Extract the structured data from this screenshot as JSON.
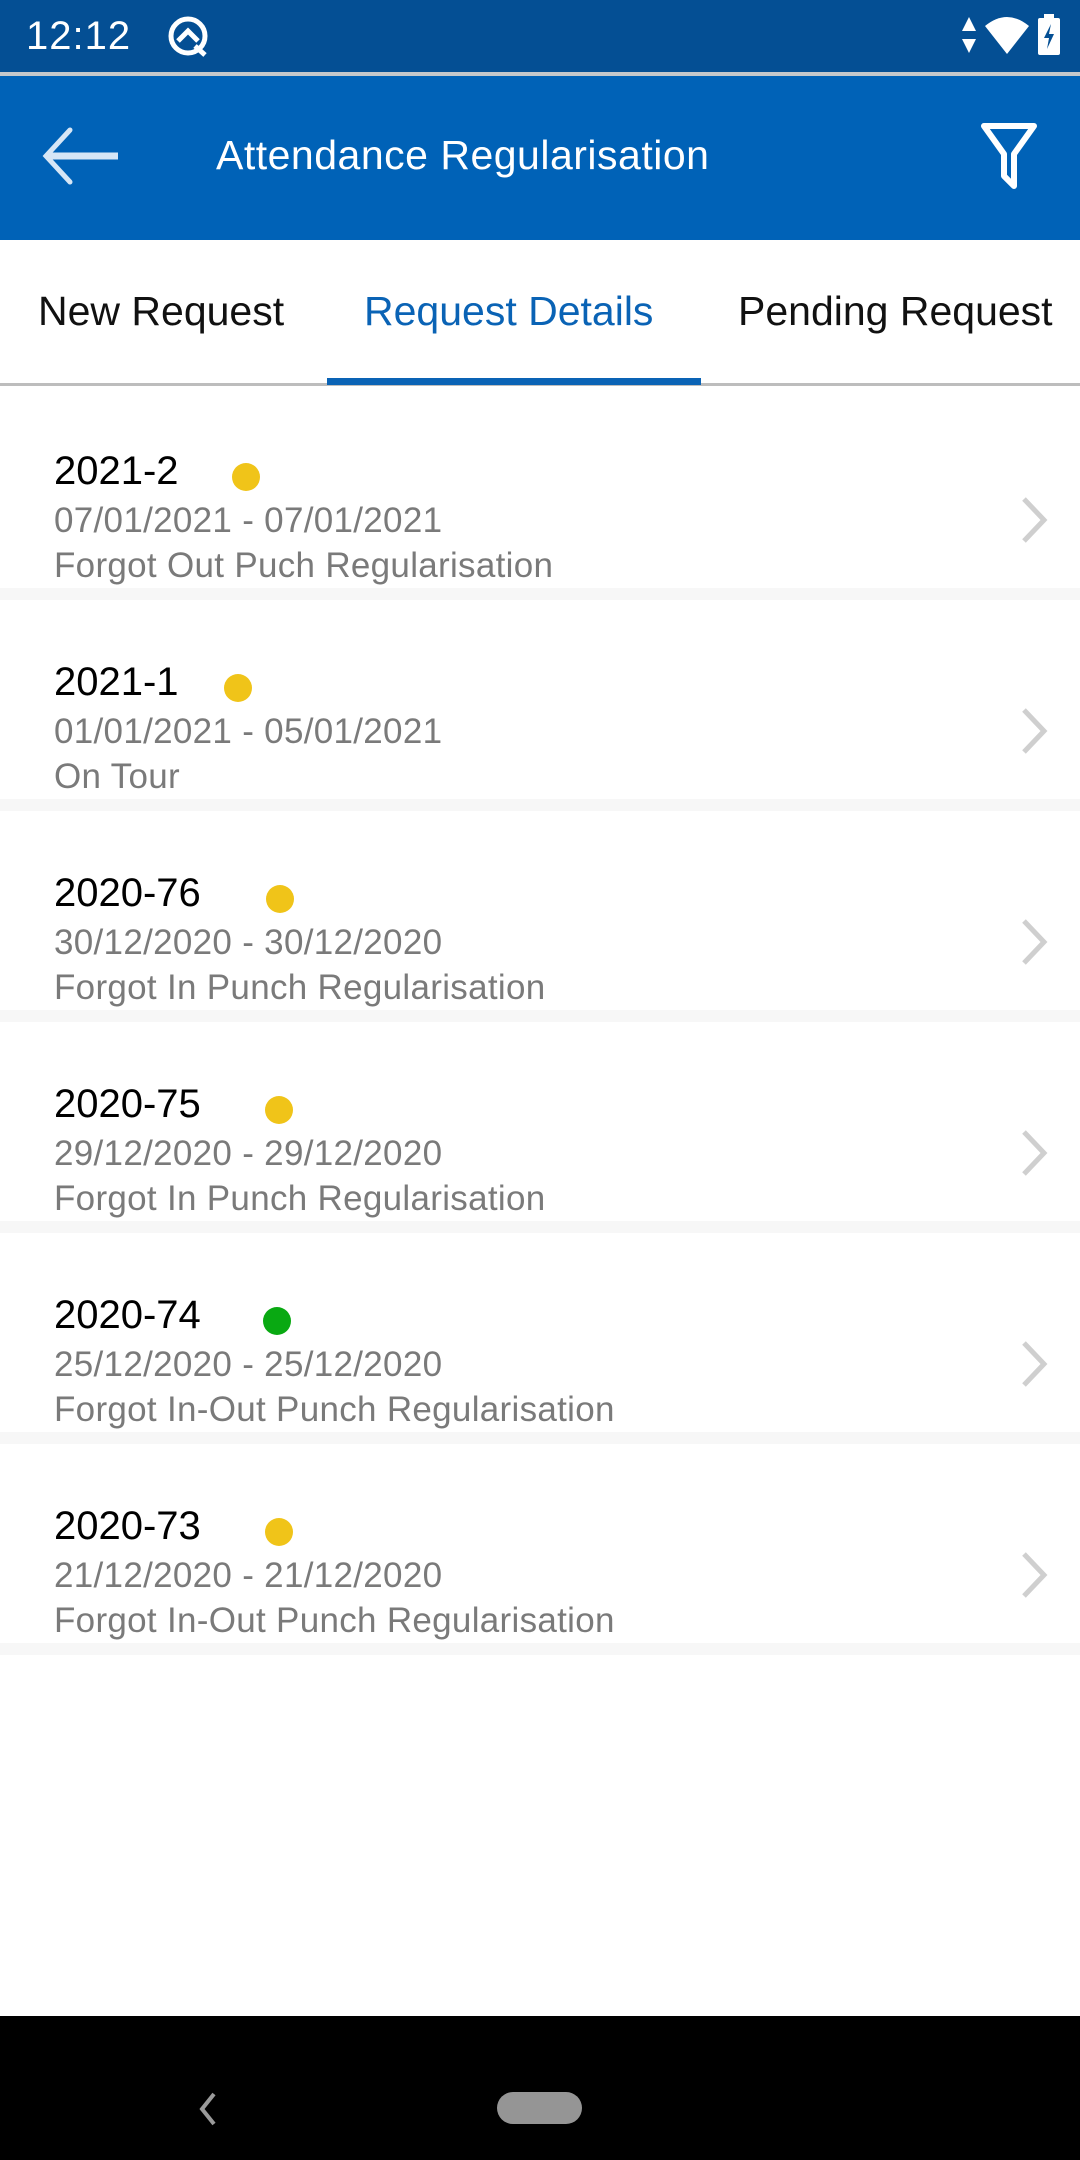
{
  "status_bar": {
    "time": "12:12",
    "icons": [
      "app-notification-icon",
      "data-transfer-icon",
      "wifi-icon",
      "battery-charging-icon"
    ]
  },
  "app_bar": {
    "title": "Attendance Regularisation",
    "back_icon": "arrow-left-icon",
    "filter_icon": "filter-icon"
  },
  "tabs": [
    {
      "label": "New Request",
      "active": false
    },
    {
      "label": "Request Details",
      "active": true
    },
    {
      "label": "Pending Request",
      "active": false
    }
  ],
  "colors": {
    "primary": "#0062b7",
    "status_bar": "#044f94",
    "active_tab": "#0a63b5",
    "status_pending": "#f0c419",
    "status_approved": "#09a912",
    "secondary_text": "#7a7a7a"
  },
  "requests": [
    {
      "id": "2021-2",
      "status": "pending",
      "status_color": "#f0c419",
      "dates": "07/01/2021 - 07/01/2021",
      "type": "Forgot Out Puch Regularisation"
    },
    {
      "id": "2021-1",
      "status": "pending",
      "status_color": "#f0c419",
      "dates": "01/01/2021 - 05/01/2021",
      "type": "On Tour"
    },
    {
      "id": "2020-76",
      "status": "pending",
      "status_color": "#f0c419",
      "dates": "30/12/2020 - 30/12/2020",
      "type": "Forgot In Punch Regularisation"
    },
    {
      "id": "2020-75",
      "status": "pending",
      "status_color": "#f0c419",
      "dates": "29/12/2020 - 29/12/2020",
      "type": "Forgot In Punch Regularisation"
    },
    {
      "id": "2020-74",
      "status": "approved",
      "status_color": "#09a912",
      "dates": "25/12/2020 - 25/12/2020",
      "type": "Forgot In-Out Punch Regularisation"
    },
    {
      "id": "2020-73",
      "status": "pending",
      "status_color": "#f0c419",
      "dates": "21/12/2020 - 21/12/2020",
      "type": "Forgot In-Out Punch Regularisation"
    }
  ],
  "nav_bar": {
    "back_icon": "nav-back-icon",
    "home_icon": "nav-home-pill-icon"
  }
}
